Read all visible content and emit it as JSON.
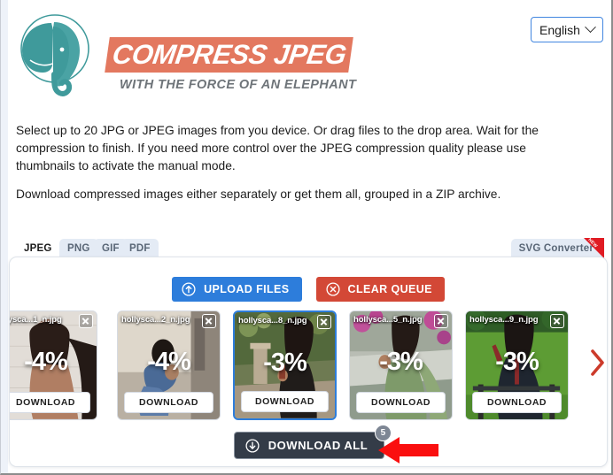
{
  "brand": {
    "title": "COMPRESS JPEG",
    "tagline": "WITH THE FORCE OF AN ELEPHANT",
    "logo_icon": "elephant-logo-icon",
    "banner_color": "#e3785f",
    "logo_color": "#3f9a9b"
  },
  "language": {
    "selected": "English",
    "chevron_icon": "chevron-down-icon",
    "border_color": "#4186e0"
  },
  "intro": {
    "paragraph1": "Select up to 20 JPG or JPEG images from you device. Or drag files to the drop area. Wait for the compression to finish. If you need more control over the JPEG compression quality please use thumbnails to activate the manual mode.",
    "paragraph2": "Download compressed images either separately or get them all, grouped in a ZIP archive."
  },
  "tabs": {
    "items": [
      {
        "id": "jpeg",
        "label": "JPEG",
        "active": true
      },
      {
        "id": "png",
        "label": "PNG",
        "active": false
      },
      {
        "id": "gif",
        "label": "GIF",
        "active": false
      },
      {
        "id": "pdf",
        "label": "PDF",
        "active": false
      }
    ],
    "right_tab": {
      "label": "SVG Converter",
      "ribbon_label": "NEW",
      "ribbon_color": "#e01b23"
    }
  },
  "toolbar": {
    "upload_label": "UPLOAD FILES",
    "upload_icon": "upload-circle-icon",
    "upload_color": "#2d7ddb",
    "clear_label": "CLEAR QUEUE",
    "clear_icon": "close-circle-icon",
    "clear_color": "#d34836"
  },
  "carousel": {
    "prev_icon": "chevron-left-icon",
    "next_icon": "chevron-right-icon",
    "arrow_color": "#cc3b2b",
    "thumbnails": [
      {
        "filename": "ollysca...1_n.jpg",
        "reduction": "-4%",
        "download_label": "DOWNLOAD",
        "close_icon": "close-icon",
        "selected": false
      },
      {
        "filename": "hollysca...2_n.jpg",
        "reduction": "-4%",
        "download_label": "DOWNLOAD",
        "close_icon": "close-icon",
        "selected": false
      },
      {
        "filename": "hollysca...8_n.jpg",
        "reduction": "-3%",
        "download_label": "DOWNLOAD",
        "close_icon": "close-icon",
        "selected": true
      },
      {
        "filename": "hollysca...5_n.jpg",
        "reduction": "-3%",
        "download_label": "DOWNLOAD",
        "close_icon": "close-icon",
        "selected": false
      },
      {
        "filename": "hollysca...9_n.jpg",
        "reduction": "-3%",
        "download_label": "DOWNLOAD",
        "close_icon": "close-icon",
        "selected": false
      }
    ]
  },
  "download_all": {
    "label": "DOWNLOAD ALL",
    "icon": "download-circle-icon",
    "badge_count": "5",
    "button_color": "#343c48"
  },
  "annotation": {
    "arrow_icon": "arrow-left-annotation-icon",
    "arrow_color": "#fa0f0f"
  }
}
